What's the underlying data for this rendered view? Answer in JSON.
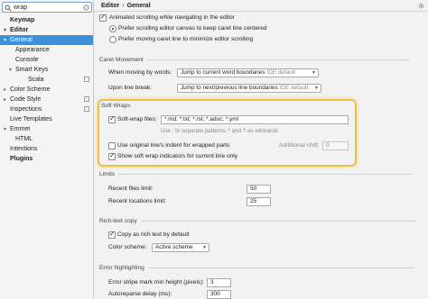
{
  "search": {
    "value": "wrap"
  },
  "sidebar": {
    "items": [
      {
        "label": "Keymap",
        "bold": true,
        "arrow": "",
        "indent": 0,
        "gear": false
      },
      {
        "label": "Editor",
        "bold": true,
        "arrow": "▾",
        "indent": 0,
        "gear": false
      },
      {
        "label": "General",
        "bold": false,
        "arrow": "▾",
        "indent": 1,
        "gear": false,
        "selected": true
      },
      {
        "label": "Appearance",
        "bold": false,
        "arrow": "",
        "indent": 2,
        "gear": false
      },
      {
        "label": "Console",
        "bold": false,
        "arrow": "",
        "indent": 2,
        "gear": false
      },
      {
        "label": "Smart Keys",
        "bold": false,
        "arrow": "▾",
        "indent": 2,
        "gear": false
      },
      {
        "label": "Scala",
        "bold": false,
        "arrow": "",
        "indent": 3,
        "gear": true
      },
      {
        "label": "Color Scheme",
        "bold": false,
        "arrow": "▸",
        "indent": 1,
        "gear": false
      },
      {
        "label": "Code Style",
        "bold": false,
        "arrow": "▸",
        "indent": 1,
        "gear": true
      },
      {
        "label": "Inspections",
        "bold": false,
        "arrow": "",
        "indent": 1,
        "gear": true
      },
      {
        "label": "Live Templates",
        "bold": false,
        "arrow": "",
        "indent": 1,
        "gear": false
      },
      {
        "label": "Emmet",
        "bold": false,
        "arrow": "▾",
        "indent": 1,
        "gear": false
      },
      {
        "label": "HTML",
        "bold": false,
        "arrow": "",
        "indent": 2,
        "gear": false
      },
      {
        "label": "Intentions",
        "bold": false,
        "arrow": "",
        "indent": 1,
        "gear": false
      },
      {
        "label": "Plugins",
        "bold": true,
        "arrow": "",
        "indent": 0,
        "gear": false
      }
    ]
  },
  "breadcrumb": {
    "first": "Editor",
    "sep": "›",
    "second": "General"
  },
  "scrolling": {
    "animated": "Animated scrolling while navigating in the editor",
    "prefer_canvas": "Prefer scrolling editor canvas to keep caret line centered",
    "prefer_caret": "Prefer moving caret line to minimize editor scrolling"
  },
  "caret": {
    "title": "Caret Movement",
    "words_label": "When moving by words:",
    "words_value": "Jump to current word boundaries",
    "words_hint": "IDE default",
    "break_label": "Upon line break:",
    "break_value": "Jump to next/previous line boundaries",
    "break_hint": "IDE default"
  },
  "soft_wraps": {
    "title": "Soft Wraps",
    "files_label": "Soft-wrap files:",
    "files_value": "*.md; *.txt; *.rst; *.adoc; *.yml",
    "files_hint": "Use ; to separate patterns, * and ? as wildcards",
    "original_indent": "Use original line's indent for wrapped parts",
    "additional_shift": "Additional shift:",
    "additional_shift_value": "0",
    "show_indicators": "Show soft wrap indicators for current line only"
  },
  "limits": {
    "title": "Limits",
    "recent_files_label": "Recent files limit:",
    "recent_files_value": "50",
    "recent_locations_label": "Recent locations limit:",
    "recent_locations_value": "25"
  },
  "rich_text": {
    "title": "Rich-text copy",
    "copy_label": "Copy as rich text by default",
    "scheme_label": "Color scheme:",
    "scheme_value": "Active scheme"
  },
  "error": {
    "title": "Error highlighting",
    "stripe_label": "Error stripe mark min height (pixels):",
    "stripe_value": "3",
    "delay_label": "Autoreparse delay (ms):",
    "delay_value": "300"
  },
  "colors": {
    "selection": "#3d8fd8",
    "highlight": "#f0c040"
  }
}
